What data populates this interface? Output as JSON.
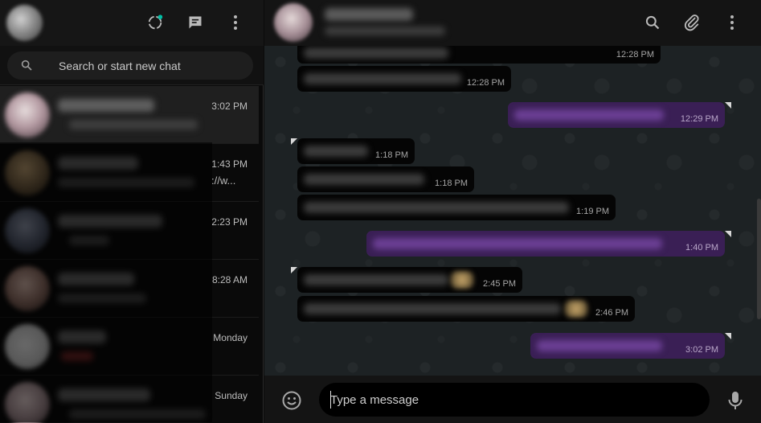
{
  "sidebar": {
    "search": {
      "placeholder": "Search or start new chat"
    },
    "chats": [
      {
        "time": "3:02 PM",
        "snippet": "",
        "active": true
      },
      {
        "time": "1:43 PM",
        "snippet": "://w..."
      },
      {
        "time": "2:23 PM",
        "snippet": ""
      },
      {
        "time": "8:28 AM",
        "snippet": ""
      },
      {
        "time": "Monday",
        "snippet": ""
      },
      {
        "time": "Sunday",
        "snippet": ""
      }
    ]
  },
  "conversation": {
    "messages": [
      {
        "dir": "in",
        "time": "12:28 PM"
      },
      {
        "dir": "in",
        "time": "12:28 PM"
      },
      {
        "dir": "out",
        "time": "12:29 PM"
      },
      {
        "dir": "in",
        "time": "1:18 PM"
      },
      {
        "dir": "in",
        "time": "1:18 PM"
      },
      {
        "dir": "in",
        "time": "1:19 PM"
      },
      {
        "dir": "out",
        "time": "1:40 PM"
      },
      {
        "dir": "in",
        "time": "2:45 PM"
      },
      {
        "dir": "in",
        "time": "2:46 PM"
      },
      {
        "dir": "out",
        "time": "3:02 PM"
      }
    ]
  },
  "composer": {
    "placeholder": "Type a message"
  },
  "icons": {
    "status": "status-icon",
    "new_chat": "new-chat-icon",
    "menu": "menu-dots-icon",
    "search": "search-icon",
    "attach": "paperclip-icon",
    "emoji": "emoji-icon",
    "mic": "microphone-icon"
  },
  "colors": {
    "accent": "#00bfa5",
    "outgoing_bubble": "#3a1f55",
    "incoming_bubble": "#050505",
    "panel_header": "#161616"
  }
}
